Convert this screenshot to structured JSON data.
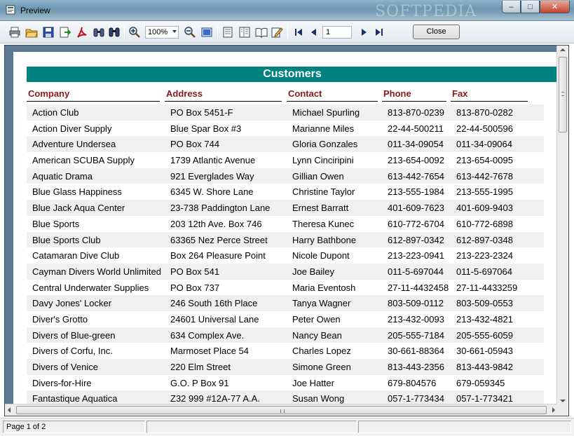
{
  "window": {
    "title": "Preview",
    "watermark": "SOFTPEDIA"
  },
  "toolbar": {
    "icons": [
      "print-icon",
      "open-icon",
      "save-icon",
      "export-icon",
      "pdf-icon",
      "binoculars-icon",
      "find-icon",
      "zoom-in-icon",
      "zoom-out-icon",
      "fit-page-icon",
      "single-page-icon",
      "multi-page-icon",
      "book-icon",
      "edit-icon",
      "first-page-icon",
      "prev-page-icon",
      "next-page-icon",
      "last-page-icon"
    ],
    "zoom": "100%",
    "page": "1",
    "close_label": "Close"
  },
  "report": {
    "title": "Customers",
    "headers": {
      "company": "Company",
      "address": "Address",
      "contact": "Contact",
      "phone": "Phone",
      "fax": "Fax"
    },
    "rows": [
      {
        "company": "Action Club",
        "address": "PO Box 5451-F",
        "contact": "Michael Spurling",
        "phone": "813-870-0239",
        "fax": "813-870-0282"
      },
      {
        "company": "Action Diver Supply",
        "address": "Blue Spar Box #3",
        "contact": "Marianne Miles",
        "phone": "22-44-500211",
        "fax": "22-44-500596"
      },
      {
        "company": "Adventure Undersea",
        "address": "PO Box 744",
        "contact": "Gloria Gonzales",
        "phone": "011-34-09054",
        "fax": "011-34-09064"
      },
      {
        "company": "American SCUBA Supply",
        "address": "1739 Atlantic Avenue",
        "contact": "Lynn Cinciripini",
        "phone": "213-654-0092",
        "fax": "213-654-0095"
      },
      {
        "company": "Aquatic Drama",
        "address": "921 Everglades Way",
        "contact": "Gillian Owen",
        "phone": "613-442-7654",
        "fax": "613-442-7678"
      },
      {
        "company": "Blue Glass Happiness",
        "address": "6345 W. Shore Lane",
        "contact": "Christine Taylor",
        "phone": "213-555-1984",
        "fax": "213-555-1995"
      },
      {
        "company": "Blue Jack Aqua Center",
        "address": "23-738 Paddington Lane",
        "contact": "Ernest Barratt",
        "phone": "401-609-7623",
        "fax": "401-609-9403"
      },
      {
        "company": "Blue Sports",
        "address": "203 12th Ave. Box 746",
        "contact": "Theresa Kunec",
        "phone": "610-772-6704",
        "fax": "610-772-6898"
      },
      {
        "company": "Blue Sports Club",
        "address": "63365 Nez Perce Street",
        "contact": "Harry Bathbone",
        "phone": "612-897-0342",
        "fax": "612-897-0348"
      },
      {
        "company": "Catamaran Dive Club",
        "address": "Box 264 Pleasure Point",
        "contact": "Nicole Dupont",
        "phone": "213-223-0941",
        "fax": "213-223-2324"
      },
      {
        "company": "Cayman Divers World Unlimited",
        "address": "PO Box 541",
        "contact": "Joe Bailey",
        "phone": "011-5-697044",
        "fax": "011-5-697064"
      },
      {
        "company": "Central Underwater Supplies",
        "address": "PO Box 737",
        "contact": "Maria Eventosh",
        "phone": "27-11-4432458",
        "fax": "27-11-4433259"
      },
      {
        "company": "Davy Jones' Locker",
        "address": "246 South 16th Place",
        "contact": "Tanya Wagner",
        "phone": "803-509-0112",
        "fax": "803-509-0553"
      },
      {
        "company": "Diver's Grotto",
        "address": "24601 Universal Lane",
        "contact": "Peter Owen",
        "phone": "213-432-0093",
        "fax": "213-432-4821"
      },
      {
        "company": "Divers of Blue-green",
        "address": "634 Complex Ave.",
        "contact": "Nancy Bean",
        "phone": "205-555-7184",
        "fax": "205-555-6059"
      },
      {
        "company": "Divers of Corfu, Inc.",
        "address": "Marmoset Place 54",
        "contact": "Charles Lopez",
        "phone": "30-661-88364",
        "fax": "30-661-05943"
      },
      {
        "company": "Divers of Venice",
        "address": "220 Elm Street",
        "contact": "Simone Green",
        "phone": "813-443-2356",
        "fax": "813-443-9842"
      },
      {
        "company": "Divers-for-Hire",
        "address": "G.O. P Box 91",
        "contact": "Joe Hatter",
        "phone": "679-804576",
        "fax": "679-059345"
      },
      {
        "company": "Fantastique Aquatica",
        "address": "Z32 999 #12A-77 A.A.",
        "contact": "Susan Wong",
        "phone": "057-1-773434",
        "fax": "057-1-773421"
      }
    ]
  },
  "status": {
    "page_info": "Page 1 of 2"
  }
}
